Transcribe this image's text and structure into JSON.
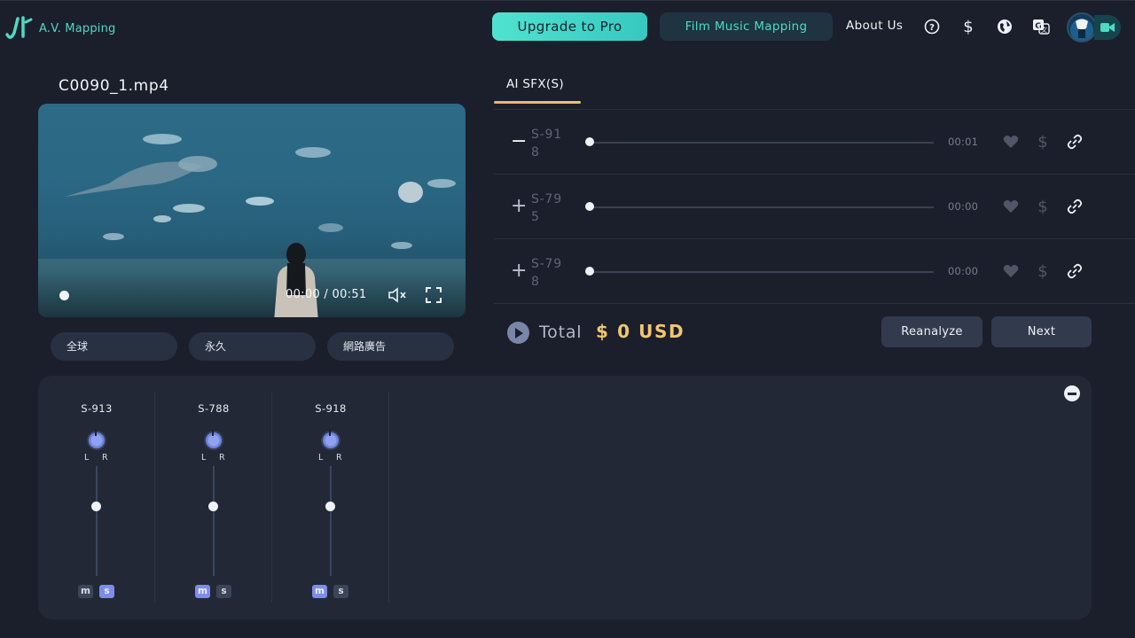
{
  "header": {
    "logo_text": "A.V. Mapping",
    "upgrade_label": "Upgrade to Pro",
    "film_music_label": "Film Music Mapping",
    "about_label": "About Us",
    "icons": [
      "help-icon",
      "dollar-icon",
      "globe-icon",
      "translate-icon",
      "video-icon"
    ]
  },
  "video": {
    "file_name": "C0090_1.mp4",
    "time": "00:00 / 00:51",
    "progress": 0.0
  },
  "tags": [
    "全球",
    "永久",
    "網路廣告"
  ],
  "sfx_panel": {
    "tab_label": "AI SFX(S)",
    "rows": [
      {
        "toggle": "−",
        "id": "S-918",
        "time": "00:01",
        "progress": 0.0
      },
      {
        "toggle": "+",
        "id": "S-795",
        "time": "00:00",
        "progress": 0.0
      },
      {
        "toggle": "+",
        "id": "S-798",
        "time": "00:00",
        "progress": 0.0
      }
    ],
    "total_label": "Total",
    "total_value": "$ 0 USD",
    "reanalyze_label": "Reanalyze",
    "next_label": "Next"
  },
  "mixer": {
    "channels": [
      {
        "name": "S-913",
        "l": "L",
        "r": "R",
        "m": "m",
        "s": "s",
        "m_on": false,
        "s_on": true
      },
      {
        "name": "S-788",
        "l": "L",
        "r": "R",
        "m": "m",
        "s": "s",
        "m_on": true,
        "s_on": false
      },
      {
        "name": "S-918",
        "l": "L",
        "r": "R",
        "m": "m",
        "s": "s",
        "m_on": true,
        "s_on": false
      }
    ]
  },
  "colors": {
    "accent": "#4fd9c4",
    "price": "#f3c56f",
    "background": "#1b1f2b",
    "mixer_active": "#7d8de8"
  }
}
